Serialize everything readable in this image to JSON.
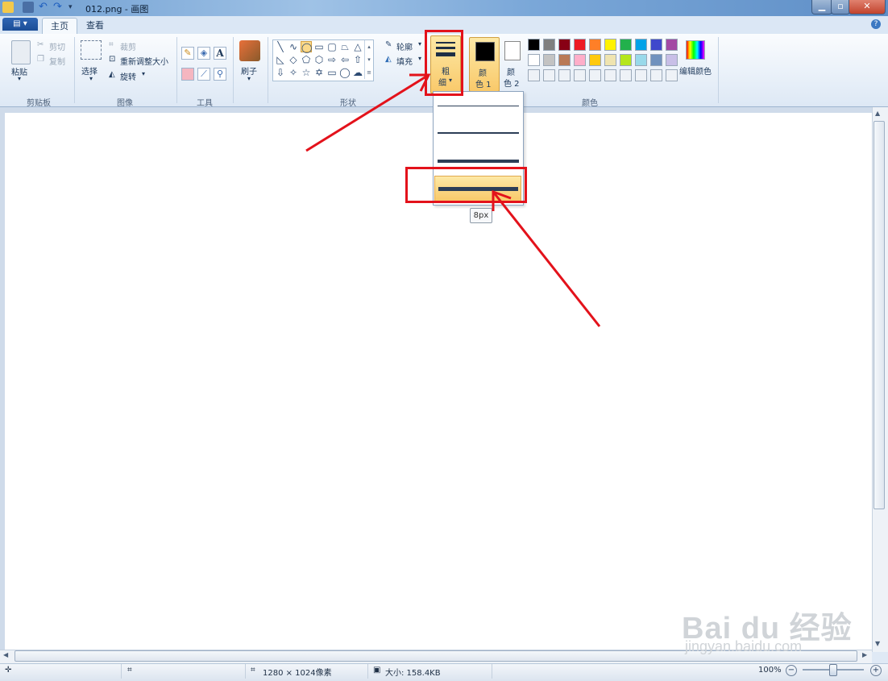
{
  "window": {
    "title": "012.png - 画图"
  },
  "tabs": {
    "file_label": "▤ ▾",
    "home": "主页",
    "view": "查看"
  },
  "clipboard": {
    "paste": "粘贴",
    "cut": "剪切",
    "copy": "复制",
    "group": "剪贴板"
  },
  "image": {
    "select": "选择",
    "crop": "裁剪",
    "resize": "重新调整大小",
    "rotate": "旋转",
    "group": "图像"
  },
  "tools": {
    "group": "工具",
    "text_glyph": "A"
  },
  "brushes": {
    "label": "刷子"
  },
  "shapes": {
    "group": "形状",
    "outline": "轮廓",
    "fill": "填充"
  },
  "size": {
    "label_line1": "粗",
    "label_line2": "细"
  },
  "colors": {
    "color1_line1": "颜",
    "color1_line2": "色 1",
    "color2_line1": "颜",
    "color2_line2": "色 2",
    "edit": "编辑颜色",
    "group": "颜色",
    "palette_row1": [
      "#000000",
      "#7f7f7f",
      "#880015",
      "#ed1c24",
      "#ff7f27",
      "#fff200",
      "#22b14c",
      "#00a2e8",
      "#3f48cc",
      "#a349a4"
    ],
    "palette_row2": [
      "#ffffff",
      "#c3c3c3",
      "#b97a57",
      "#ffaec9",
      "#ffc90e",
      "#efe4b0",
      "#b5e61d",
      "#99d9ea",
      "#7092be",
      "#c8bfe7"
    ]
  },
  "size_dropdown": {
    "tooltip": "8px"
  },
  "status": {
    "dimensions": "1280 × 1024像素",
    "file_size": "大小: 158.4KB",
    "zoom": "100%"
  },
  "watermark": {
    "line1": "Bai du 经验",
    "line2": "jingyan.baidu.com"
  }
}
